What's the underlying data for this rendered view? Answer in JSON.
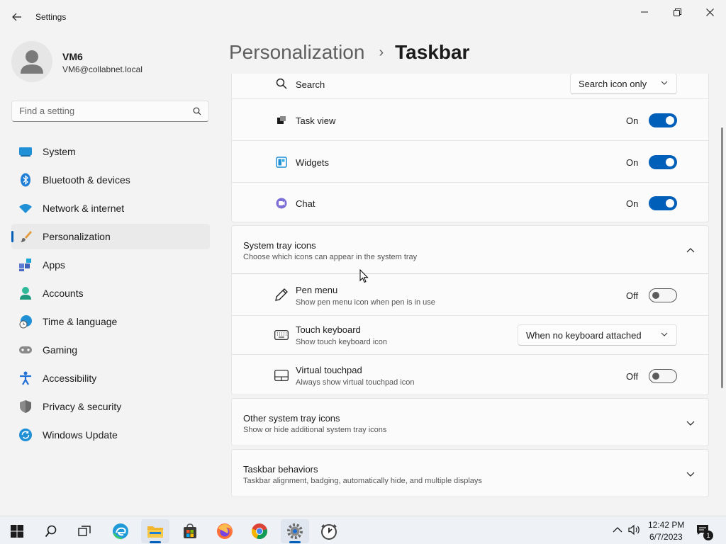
{
  "window": {
    "title": "Settings",
    "minimize_icon": "minimize-icon",
    "maximize_icon": "restore-icon",
    "close_icon": "close-icon"
  },
  "profile": {
    "name": "VM6",
    "email": "VM6@collabnet.local"
  },
  "search": {
    "placeholder": "Find a setting"
  },
  "nav": {
    "items": [
      {
        "label": "System",
        "icon": "system-icon"
      },
      {
        "label": "Bluetooth & devices",
        "icon": "bluetooth-icon"
      },
      {
        "label": "Network & internet",
        "icon": "wifi-icon"
      },
      {
        "label": "Personalization",
        "icon": "brush-icon",
        "active": true
      },
      {
        "label": "Apps",
        "icon": "apps-icon"
      },
      {
        "label": "Accounts",
        "icon": "person-icon"
      },
      {
        "label": "Time & language",
        "icon": "globe-clock-icon"
      },
      {
        "label": "Gaming",
        "icon": "gamepad-icon"
      },
      {
        "label": "Accessibility",
        "icon": "accessibility-icon"
      },
      {
        "label": "Privacy & security",
        "icon": "shield-icon"
      },
      {
        "label": "Windows Update",
        "icon": "update-icon"
      }
    ]
  },
  "header": {
    "parent": "Personalization",
    "separator": "›",
    "current": "Taskbar"
  },
  "taskbar_items": {
    "search": {
      "label": "Search",
      "value": "Search icon only"
    },
    "task_view": {
      "label": "Task view",
      "state": "On"
    },
    "widgets": {
      "label": "Widgets",
      "state": "On"
    },
    "chat": {
      "label": "Chat",
      "state": "On"
    }
  },
  "system_tray": {
    "title": "System tray icons",
    "subtitle": "Choose which icons can appear in the system tray",
    "pen_menu": {
      "label": "Pen menu",
      "sub": "Show pen menu icon when pen is in use",
      "state": "Off"
    },
    "touch_keyboard": {
      "label": "Touch keyboard",
      "sub": "Show touch keyboard icon",
      "value": "When no keyboard attached"
    },
    "virtual_touchpad": {
      "label": "Virtual touchpad",
      "sub": "Always show virtual touchpad icon",
      "state": "Off"
    }
  },
  "other_tray": {
    "title": "Other system tray icons",
    "subtitle": "Show or hide additional system tray icons"
  },
  "behaviors": {
    "title": "Taskbar behaviors",
    "subtitle": "Taskbar alignment, badging, automatically hide, and multiple displays"
  },
  "os_taskbar": {
    "time": "12:42 PM",
    "date": "6/7/2023",
    "notification_count": "1",
    "apps": [
      "start-icon",
      "search-icon",
      "task-view-icon",
      "edge-icon",
      "file-explorer-icon",
      "store-icon",
      "firefox-icon",
      "chrome-icon",
      "settings-icon",
      "clock-app-icon"
    ]
  },
  "colors": {
    "accent": "#005fb8",
    "background": "#f3f3f3",
    "card": "#fbfbfb"
  }
}
